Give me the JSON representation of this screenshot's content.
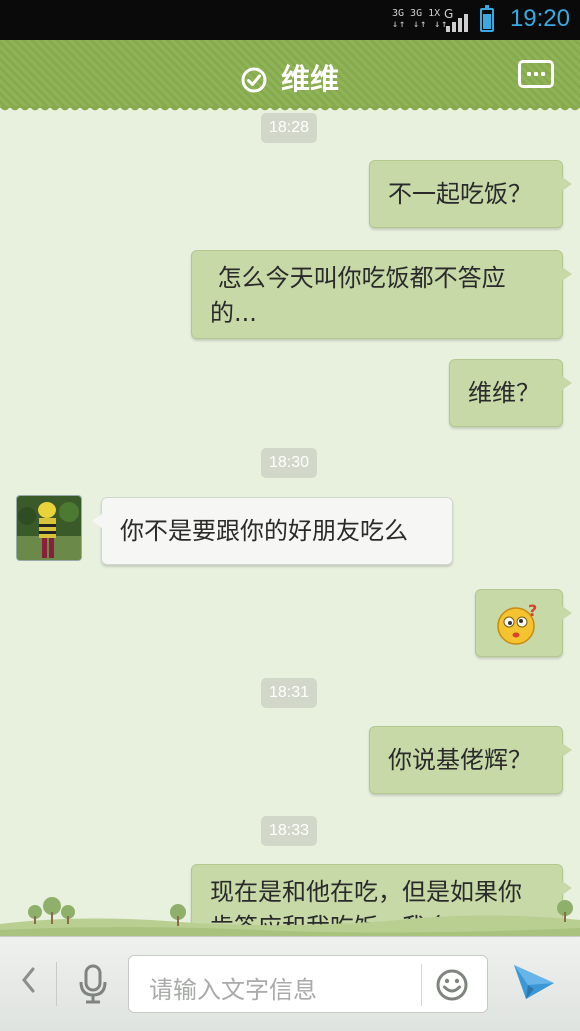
{
  "status_bar": {
    "net_line1": "3G 3G 1X",
    "net_line2": "↓↑ ↓↑ ↓↑",
    "g_label": "G",
    "time": "19:20"
  },
  "header": {
    "title": "维维"
  },
  "messages": [
    {
      "type": "time",
      "text": "18:28"
    },
    {
      "type": "out",
      "text": "不一起吃饭？"
    },
    {
      "type": "out",
      "text": " 怎么今天叫你吃饭都不答应的..."
    },
    {
      "type": "out",
      "text": "维维？"
    },
    {
      "type": "time",
      "text": "18:30"
    },
    {
      "type": "in",
      "text": "你不是要跟你的好朋友吃么"
    },
    {
      "type": "out_emoji",
      "text": "",
      "emoji": "dizzy-face-emoji"
    },
    {
      "type": "time",
      "text": "18:31"
    },
    {
      "type": "out",
      "text": "你说基佬辉？"
    },
    {
      "type": "time",
      "text": "18:33"
    },
    {
      "type": "out",
      "text": "现在是和他在吃，但是如果你肯答应和我吃饭，我会果"
    }
  ],
  "input_bar": {
    "placeholder": "请输入文字信息"
  },
  "icons": {
    "check": "check-circle-icon",
    "menu": "more-options-icon",
    "back": "chevron-left-icon",
    "mic": "microphone-icon",
    "emoji": "smiley-icon",
    "send": "send-plane-icon"
  },
  "colors": {
    "header": "#8fb357",
    "chat_bg": "#e8f0de",
    "my_bubble": "#c6d9a7",
    "their_bubble": "#f6f7f4",
    "time_chip": "#d2d8c9",
    "status_time": "#39a9e0"
  }
}
